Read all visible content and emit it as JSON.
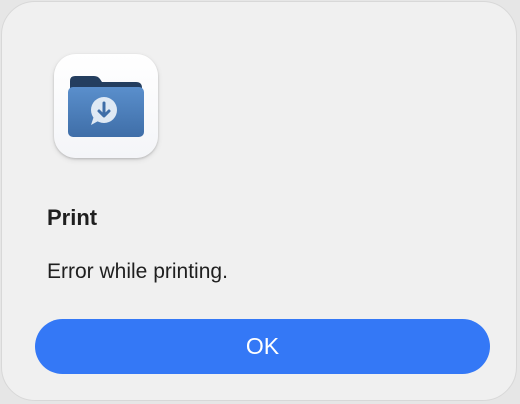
{
  "dialog": {
    "icon": "folder-download-icon",
    "title": "Print",
    "message": "Error while printing.",
    "ok_label": "OK"
  },
  "colors": {
    "button": "#3478f6",
    "folder_back": "#243e5f",
    "folder_front": "#4f82bd",
    "badge": "#dfe9f4"
  }
}
